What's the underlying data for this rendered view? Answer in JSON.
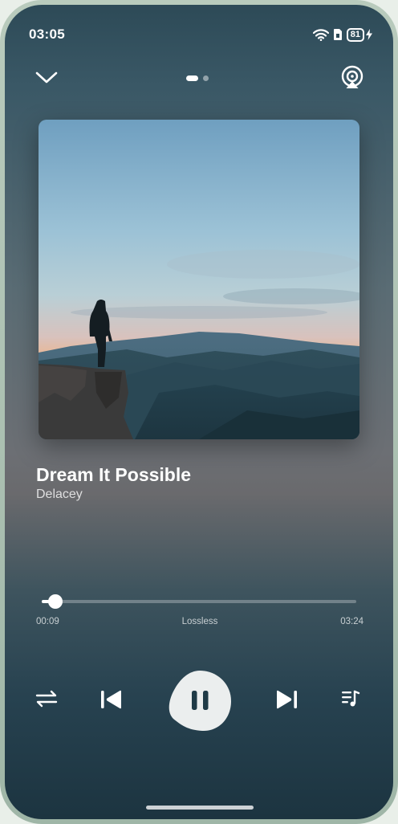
{
  "status_bar": {
    "time": "03:05",
    "battery_level": "81",
    "icons": [
      "wifi-icon",
      "sim-icon",
      "battery-icon",
      "charging-icon"
    ]
  },
  "header": {
    "collapse_icon": "chevron-down-icon",
    "cast_icon": "cast-icon",
    "page_indicator": {
      "count": 2,
      "active": 0
    }
  },
  "album": {
    "art_description_icon": "album-art-image"
  },
  "song": {
    "title": "Dream It Possible",
    "artist": "Delacey"
  },
  "progress": {
    "elapsed": "00:09",
    "quality": "Lossless",
    "duration": "03:24",
    "fraction": 0.044
  },
  "controls": {
    "shuffle_icon": "repeat-icon",
    "prev_icon": "skip-previous-icon",
    "play_icon": "pause-icon",
    "next_icon": "skip-next-icon",
    "queue_icon": "playlist-icon"
  },
  "colors": {
    "accent": "#ffffff",
    "background_top": "#2d4a57",
    "background_bottom": "#1c3440"
  }
}
